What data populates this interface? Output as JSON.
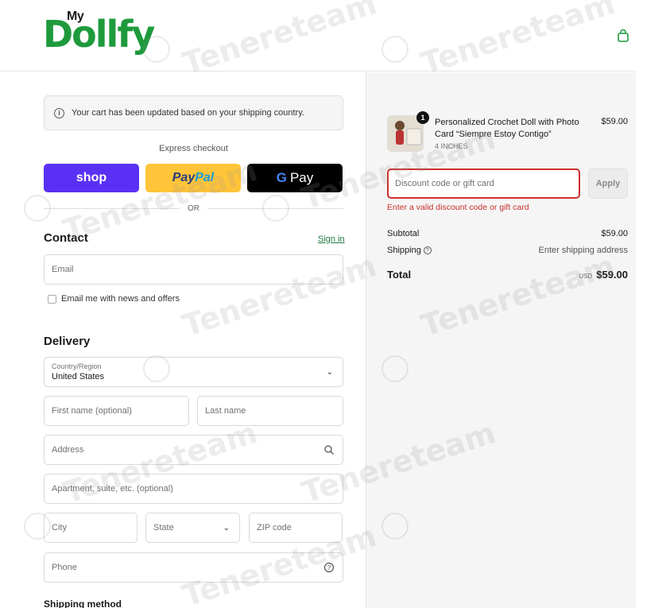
{
  "brand": {
    "logo_prefix": "My",
    "logo_name": "Dollfy"
  },
  "header": {
    "cart_icon": "shopping-bag-icon"
  },
  "notice": {
    "text": "Your cart has been updated based on your shipping country.",
    "icon": "info-icon"
  },
  "express": {
    "label": "Express checkout",
    "shop_label": "shop",
    "paypal_part1": "Pay",
    "paypal_part2": "Pal",
    "gpay_g": "G",
    "gpay_label": "Pay",
    "or_label": "OR"
  },
  "contact": {
    "title": "Contact",
    "signin": "Sign in",
    "email_placeholder": "Email",
    "newsletter_label": "Email me with news and offers"
  },
  "delivery": {
    "title": "Delivery",
    "country_label": "Country/Region",
    "country_value": "United States",
    "first_name_placeholder": "First name (optional)",
    "last_name_placeholder": "Last name",
    "address_placeholder": "Address",
    "apartment_placeholder": "Apartment, suite, etc. (optional)",
    "city_placeholder": "City",
    "state_placeholder": "State",
    "zip_placeholder": "ZIP code",
    "phone_placeholder": "Phone"
  },
  "shipping_method": {
    "title": "Shipping method"
  },
  "summary": {
    "item": {
      "quantity": "1",
      "name": "Personalized Crochet Doll with Photo Card “Siempre Estoy Contigo”",
      "variant": "4 INCHES",
      "price": "$59.00"
    },
    "discount_placeholder": "Discount code or gift card",
    "apply_label": "Apply",
    "discount_error": "Enter a valid discount code or gift card",
    "subtotal_label": "Subtotal",
    "subtotal_value": "$59.00",
    "shipping_label": "Shipping",
    "shipping_value": "Enter shipping address",
    "total_label": "Total",
    "total_currency": "USD",
    "total_value": "$59.00"
  },
  "watermark": {
    "text": "Tenereteam"
  },
  "colors": {
    "brand_green": "#1e9a3c",
    "shop_purple": "#5a31f4",
    "paypal_yellow": "#ffc439",
    "error_red": "#c9302c"
  }
}
